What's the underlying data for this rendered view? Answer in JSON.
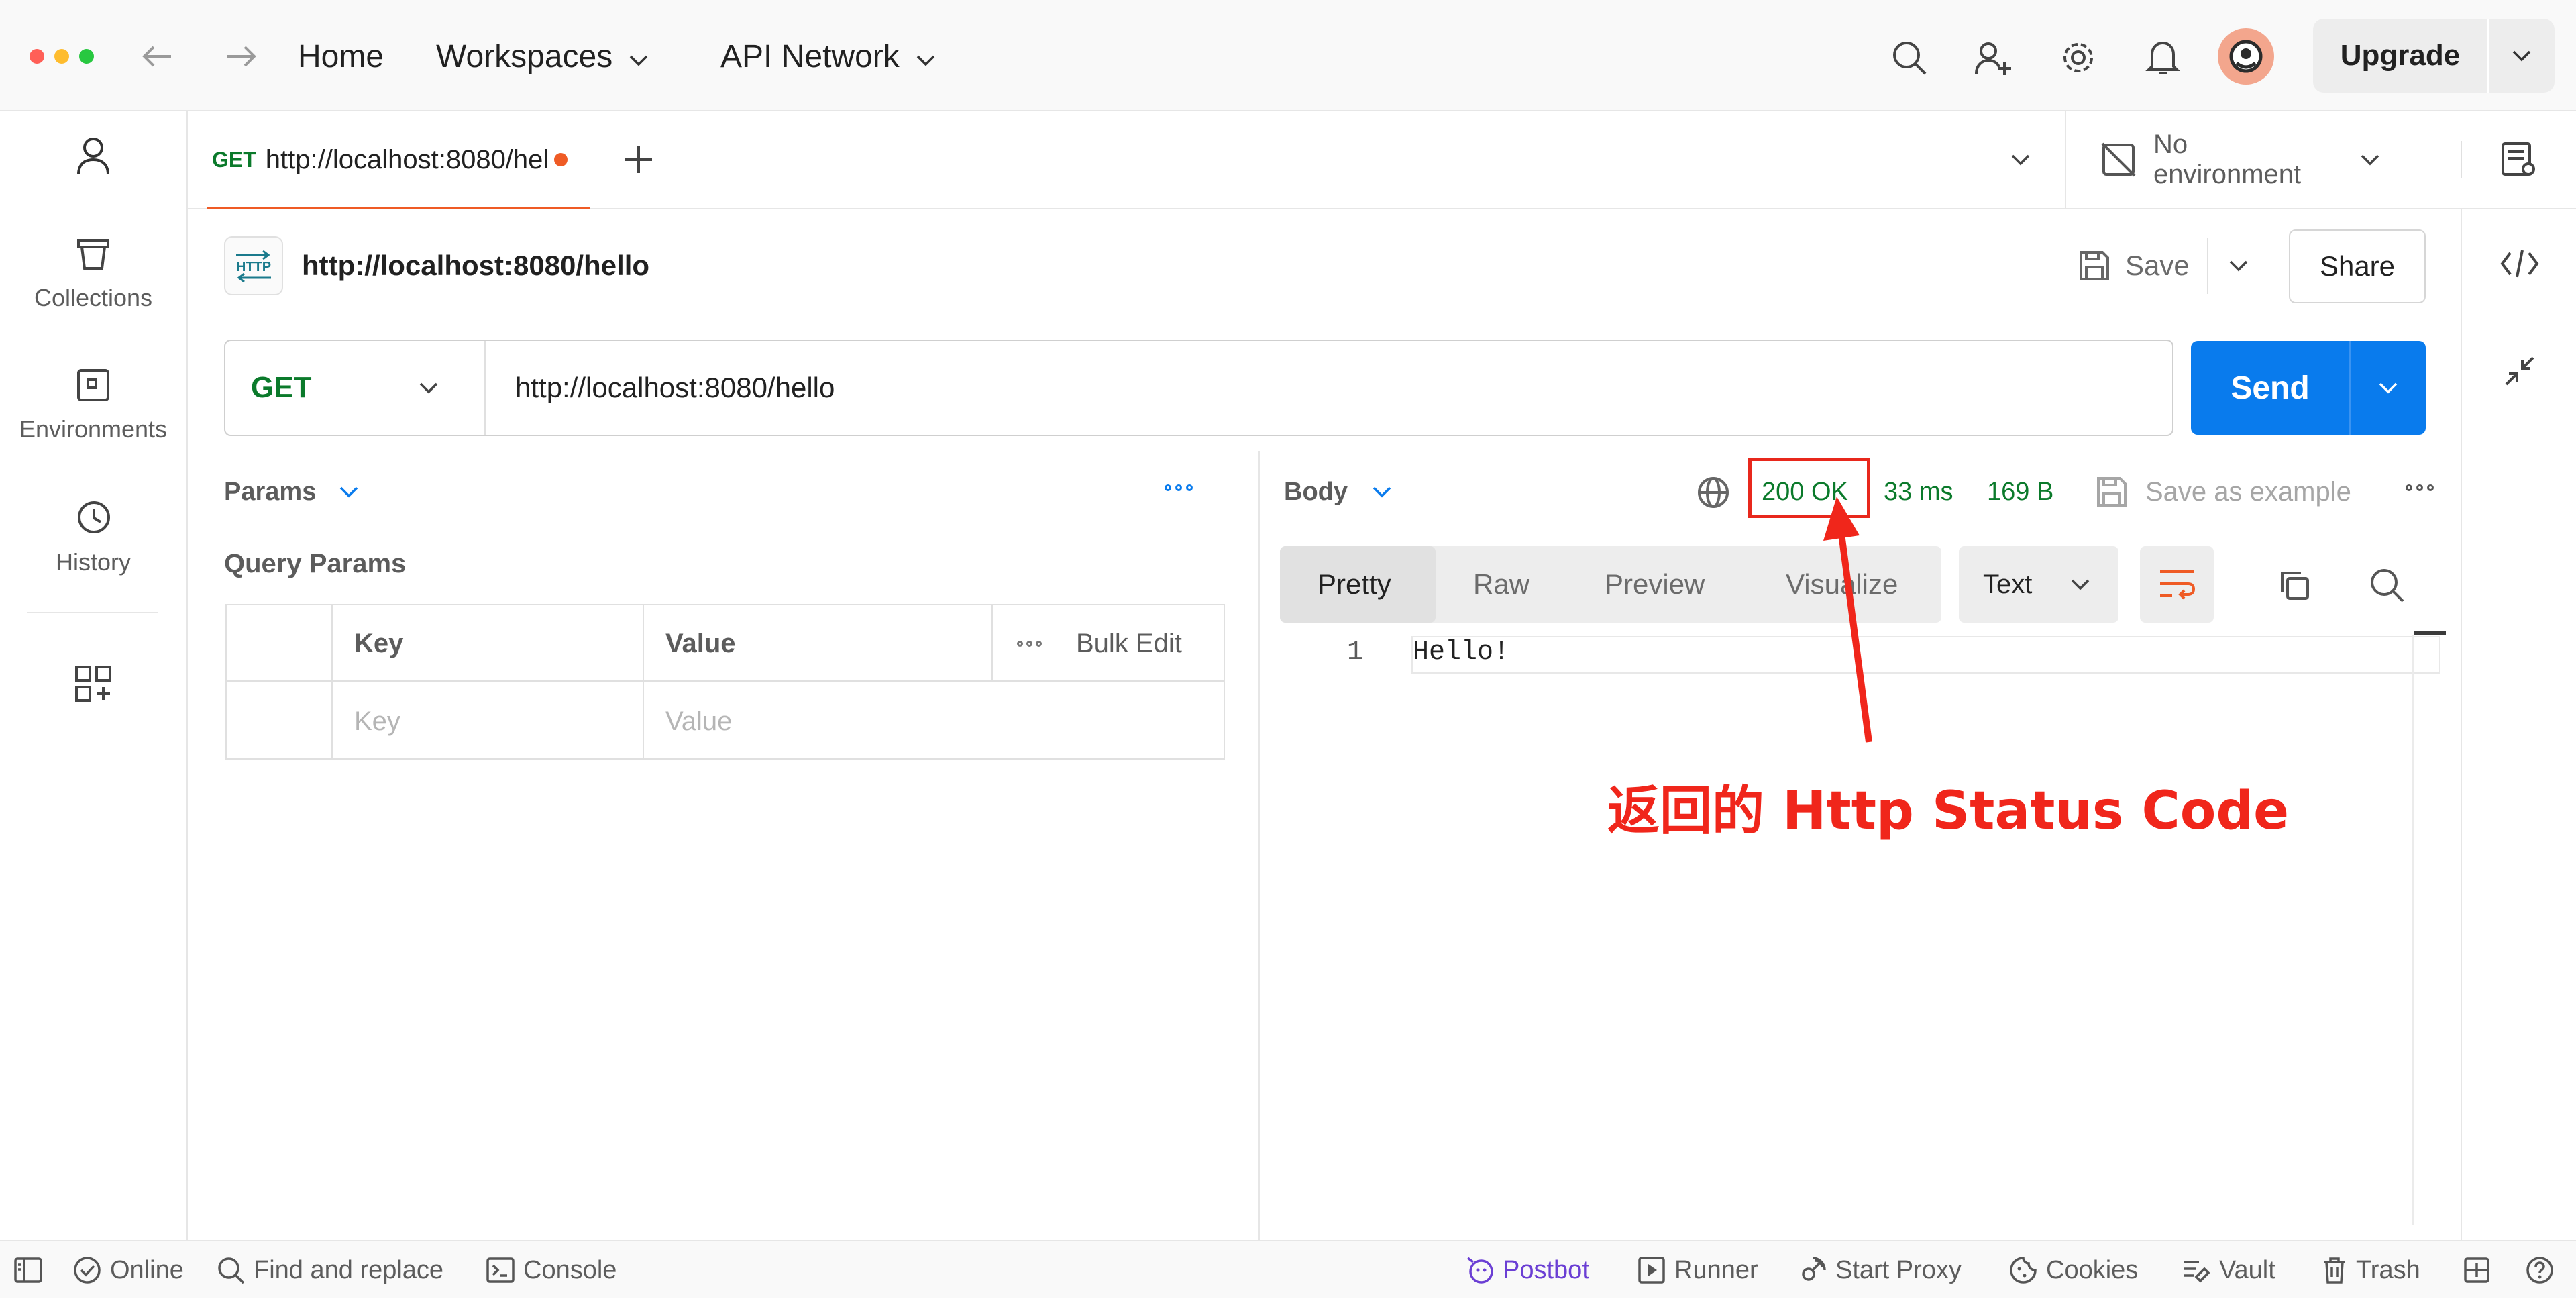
{
  "titlebar": {
    "nav": {
      "home": "Home",
      "workspaces": "Workspaces",
      "api_network": "API Network"
    },
    "upgrade_label": "Upgrade"
  },
  "sidebar": {
    "items": [
      {
        "label": "Collections"
      },
      {
        "label": "Environments"
      },
      {
        "label": "History"
      }
    ]
  },
  "tab": {
    "method": "GET",
    "url": "http://localhost:8080/hello"
  },
  "environment": {
    "label": "No environment"
  },
  "request": {
    "title": "http://localhost:8080/hello",
    "save_label": "Save",
    "share_label": "Share",
    "method": "GET",
    "url": "http://localhost:8080/hello",
    "send_label": "Send"
  },
  "params": {
    "header": "Params",
    "section_title": "Query Params",
    "columns": {
      "key": "Key",
      "value": "Value",
      "bulk_edit": "Bulk Edit"
    },
    "placeholder_row": {
      "key": "Key",
      "value": "Value"
    }
  },
  "response": {
    "header": "Body",
    "status": "200 OK",
    "time": "33 ms",
    "size": "169 B",
    "save_example": "Save as example",
    "tabs": [
      "Pretty",
      "Raw",
      "Preview",
      "Visualize"
    ],
    "format": "Text",
    "lines": [
      {
        "number": "1",
        "text": "Hello!"
      }
    ]
  },
  "annotation": {
    "text": "返回的 Http Status Code",
    "color": "#f0261b"
  },
  "statusbar": {
    "online": "Online",
    "find_replace": "Find and replace",
    "console": "Console",
    "postbot": "Postbot",
    "runner": "Runner",
    "start_proxy": "Start Proxy",
    "cookies": "Cookies",
    "vault": "Vault",
    "trash": "Trash"
  },
  "colors": {
    "accent": "#097bed",
    "get_method": "#0b7a2b",
    "tab_indicator": "#ef5b25",
    "postbot": "#6b3fd4"
  }
}
